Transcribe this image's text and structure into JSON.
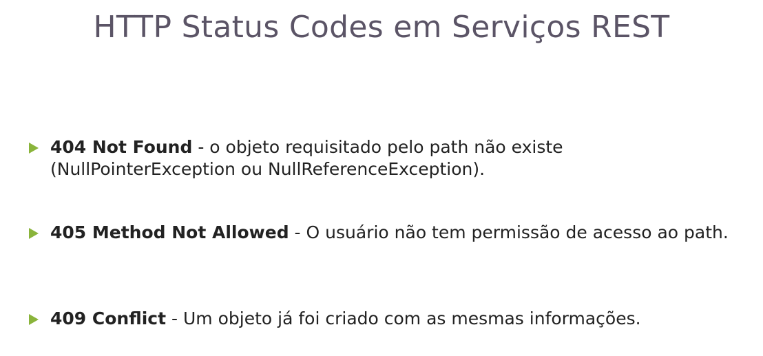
{
  "slide": {
    "title": "HTTP Status Codes em Serviços REST",
    "bullets": [
      {
        "term": "404 Not Found",
        "description": " - o objeto requisitado pelo path não existe (NullPointerException ou NullReferenceException)."
      },
      {
        "term": "405 Method Not Allowed",
        "description": " - O usuário não tem permissão de acesso ao path."
      },
      {
        "term": "409 Conflict",
        "description": " - Um objeto já foi criado com as mesmas informações."
      }
    ]
  },
  "colors": {
    "title": "#5b5466",
    "bullet_marker": "#8ab43b",
    "body_text": "#222222"
  },
  "icons": {
    "bullet_marker": "triangle-right-icon"
  }
}
